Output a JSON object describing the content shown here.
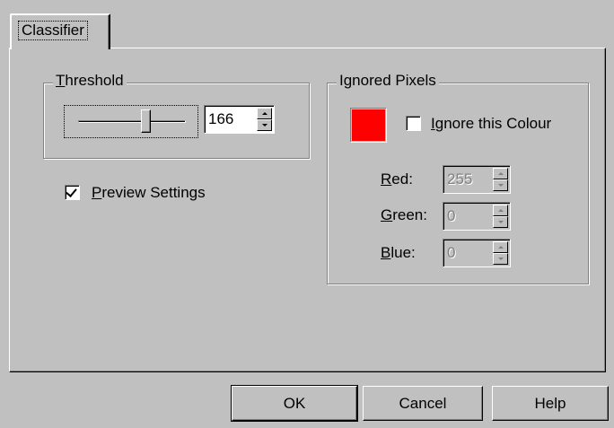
{
  "tabs": [
    {
      "label": "Classifier"
    }
  ],
  "threshold": {
    "group_title_prefix": "T",
    "group_title_rest": "hreshold",
    "slider_value": 166,
    "value_text": "166"
  },
  "preview": {
    "checked": true,
    "label_prefix": "P",
    "label_rest": "review Settings"
  },
  "ignored_pixels": {
    "group_title": "Ignored Pixels",
    "swatch_color": "#ff0000",
    "ignore_checked": false,
    "ignore_label_prefix": "I",
    "ignore_label_rest": "gnore this Colour",
    "red": {
      "label_prefix": "R",
      "label_rest": "ed:",
      "value": "255"
    },
    "green": {
      "label_prefix": "G",
      "label_rest": "reen:",
      "value": "0"
    },
    "blue": {
      "label_prefix": "B",
      "label_rest": "lue:",
      "value": "0"
    }
  },
  "buttons": {
    "ok": "OK",
    "cancel": "Cancel",
    "help": "Help"
  }
}
